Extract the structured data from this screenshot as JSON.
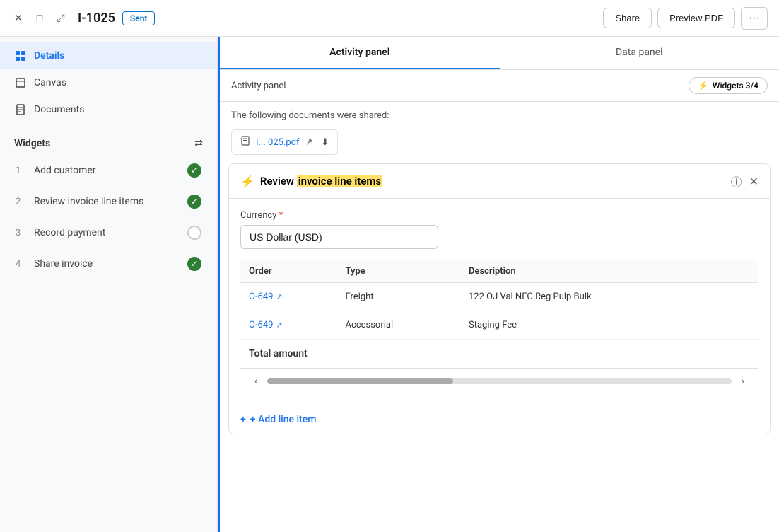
{
  "topbar": {
    "invoice_id": "I-1025",
    "status": "Sent",
    "share_label": "Share",
    "preview_pdf_label": "Preview PDF",
    "more_icon": "···"
  },
  "sidebar": {
    "nav_items": [
      {
        "id": "details",
        "label": "Details",
        "active": true,
        "icon": "grid"
      },
      {
        "id": "canvas",
        "label": "Canvas",
        "active": false,
        "icon": "doc"
      },
      {
        "id": "documents",
        "label": "Documents",
        "active": false,
        "icon": "doc"
      }
    ],
    "widgets_title": "Widgets",
    "widgets": [
      {
        "num": "1",
        "label": "Add customer",
        "status": "done"
      },
      {
        "num": "2",
        "label": "Review invoice line items",
        "status": "done"
      },
      {
        "num": "3",
        "label": "Record payment",
        "status": "pending"
      },
      {
        "num": "4",
        "label": "Share invoice",
        "status": "done"
      }
    ]
  },
  "right_panel": {
    "tabs": [
      {
        "id": "activity",
        "label": "Activity panel",
        "active": true
      },
      {
        "id": "data",
        "label": "Data panel",
        "active": false
      }
    ],
    "subbar": {
      "label": "Activity panel",
      "widgets_counter": "Widgets 3/4"
    },
    "shared_text": "The following documents were shared:",
    "pdf_link": {
      "name": "I... 025.pdf",
      "external_icon": "↗",
      "download_icon": "⬇"
    },
    "widget_card": {
      "title_prefix": "Review ",
      "title_highlight": "invoice line items",
      "currency_label": "Currency",
      "currency_required": true,
      "currency_value": "US Dollar (USD)",
      "table_headers": [
        "Order",
        "Type",
        "Description",
        ""
      ],
      "line_items": [
        {
          "order": "O-649",
          "type": "Freight",
          "description": "122 OJ Val NFC Reg Pulp Bulk"
        },
        {
          "order": "O-649",
          "type": "Accessorial",
          "description": "Staging Fee"
        }
      ],
      "total_label": "Total amount",
      "add_line_label": "+ Add line item"
    }
  },
  "icons": {
    "close": "✕",
    "minimize": "□",
    "expand": "⤢",
    "external": "↗",
    "download": "⬇",
    "info": "ⓘ",
    "bolt": "⚡",
    "grid": "⊞",
    "doc": "≡",
    "arrows": "⇄",
    "check": "✓",
    "left_arrow": "‹",
    "right_arrow": "›",
    "plus": "+"
  },
  "colors": {
    "accent": "#1a73e8",
    "success": "#2e7d32",
    "highlight": "#ffe066"
  }
}
